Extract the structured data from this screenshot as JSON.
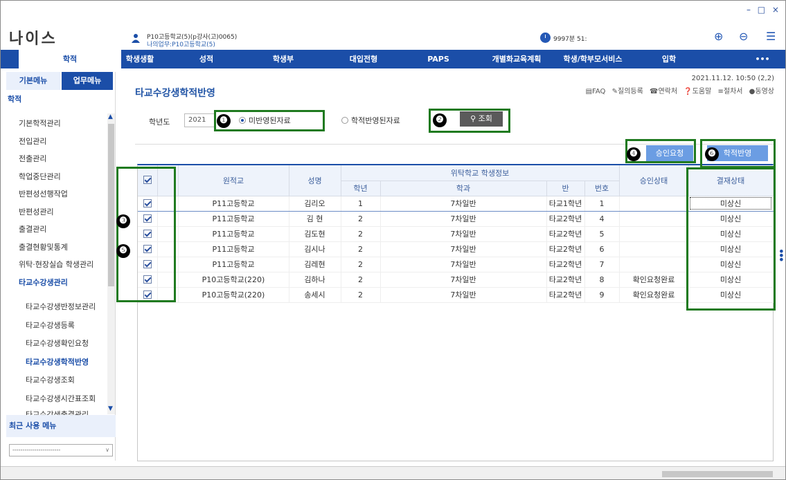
{
  "window": {
    "controls": "– □ ×"
  },
  "header": {
    "app_title": "나이스",
    "user_line1": "P10고등학교(5)(p강사(고)0065)",
    "user_line2": "나의업무:P10고등학교(5)",
    "timer": "9997분 51:",
    "icons": [
      "user-icon",
      "clock-icon",
      "zoom-in-icon",
      "zoom-out-icon",
      "menu-icon"
    ]
  },
  "topnav": {
    "items": [
      "학적",
      "학생생활",
      "성적",
      "학생부",
      "대입전형",
      "PAPS",
      "개별화교육계획",
      "학생/학부모서비스",
      "입학",
      "•••"
    ]
  },
  "sidebar": {
    "tab_basic": "기본메뉴",
    "tab_work": "업무메뉴",
    "category": "학적",
    "items": [
      "기본학적관리",
      "전입관리",
      "전출관리",
      "학업중단관리",
      "반편성선행작업",
      "반편성관리",
      "출결관리",
      "출결현황및통계",
      "위탁·현장실습 학생관리",
      "타교수강생관리"
    ],
    "sub_items": [
      "타교수강생반정보관리",
      "타교수강생등록",
      "타교수강생확인요청",
      "타교수강생학적반영",
      "타교수강생조회",
      "타교수강생시간표조회",
      "타교수강생출결관리"
    ],
    "recent_label": "최근 사용 메뉴",
    "recent_select": "------------------------"
  },
  "main": {
    "title": "타교수강생학적반영",
    "datetime": "2021.11.12. 10:50 (2,2)",
    "toolbar": [
      "▤FAQ",
      "✎질의등록",
      "☎연락처",
      "❓도움말",
      "≡절차서",
      "●동영상"
    ],
    "year_label": "학년도",
    "year_value": "2021",
    "radio_unreflected": "미반영된자료",
    "radio_reflected": "학적반영된자료",
    "search_button": "조회",
    "approve_button": "승인요청",
    "reflect_button": "학적반영",
    "badges": [
      "❶",
      "❷",
      "❸",
      "❹",
      "❺",
      "❻"
    ]
  },
  "table": {
    "headers": {
      "school": "원적교",
      "name": "성명",
      "group": "위탁학교 학생정보",
      "grade": "학년",
      "dept": "학과",
      "class": "반",
      "num": "번호",
      "approval": "승인상태",
      "payment": "결재상태"
    },
    "rows": [
      {
        "school": "P11고등학교",
        "name": "김리오",
        "grade": "1",
        "dept": "7차일반",
        "class": "타교1학년",
        "num": "1",
        "approval": "",
        "payment": "미상신"
      },
      {
        "school": "P11고등학교",
        "name": "김  현",
        "grade": "2",
        "dept": "7차일반",
        "class": "타교2학년",
        "num": "4",
        "approval": "",
        "payment": "미상신"
      },
      {
        "school": "P11고등학교",
        "name": "김도현",
        "grade": "2",
        "dept": "7차일반",
        "class": "타교2학년",
        "num": "5",
        "approval": "",
        "payment": "미상신"
      },
      {
        "school": "P11고등학교",
        "name": "김시나",
        "grade": "2",
        "dept": "7차일반",
        "class": "타교2학년",
        "num": "6",
        "approval": "",
        "payment": "미상신"
      },
      {
        "school": "P11고등학교",
        "name": "김레현",
        "grade": "2",
        "dept": "7차일반",
        "class": "타교2학년",
        "num": "7",
        "approval": "",
        "payment": "미상신"
      },
      {
        "school": "P10고등학교(220)",
        "name": "김하나",
        "grade": "2",
        "dept": "7차일반",
        "class": "타교2학년",
        "num": "8",
        "approval": "확인요청완료",
        "payment": "미상신"
      },
      {
        "school": "P10고등학교(220)",
        "name": "송세시",
        "grade": "2",
        "dept": "7차일반",
        "class": "타교2학년",
        "num": "9",
        "approval": "확인요청완료",
        "payment": "미상신"
      }
    ]
  }
}
